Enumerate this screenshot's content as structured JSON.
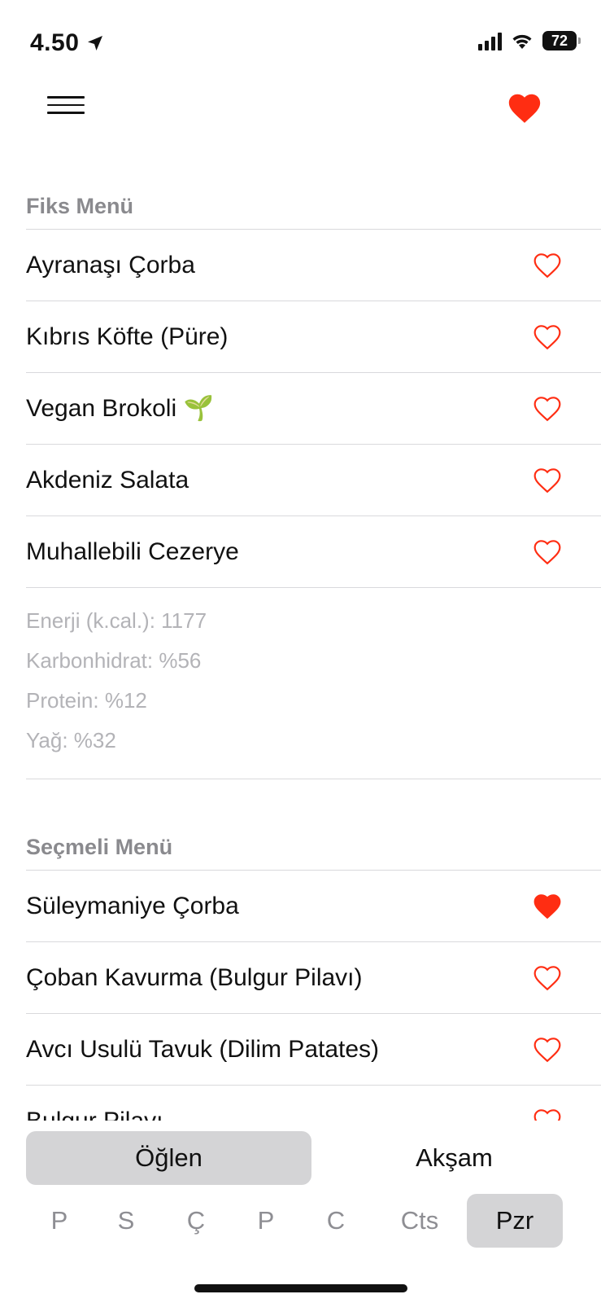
{
  "status": {
    "time": "4.50",
    "battery": "72"
  },
  "sections": [
    {
      "title": "Fiks Menü",
      "items": [
        {
          "label": "Ayranaşı Çorba",
          "favorite": false
        },
        {
          "label": "Kıbrıs Köfte (Püre)",
          "favorite": false
        },
        {
          "label": "Vegan Brokoli 🌱",
          "favorite": false
        },
        {
          "label": "Akdeniz Salata",
          "favorite": false
        },
        {
          "label": "Muhallebili Cezerye",
          "favorite": false
        }
      ],
      "nutrition": [
        "Enerji (k.cal.): 1177",
        "Karbonhidrat: %56",
        "Protein: %12",
        "Yağ: %32"
      ]
    },
    {
      "title": "Seçmeli Menü",
      "items": [
        {
          "label": "Süleymaniye Çorba",
          "favorite": true
        },
        {
          "label": "Çoban Kavurma (Bulgur Pilavı)",
          "favorite": false
        },
        {
          "label": "Avcı Usulü Tavuk (Dilim Patates)",
          "favorite": false
        },
        {
          "label": "Bulgur Pilavı",
          "favorite": false
        }
      ]
    }
  ],
  "meal_segment": {
    "options": [
      "Öğlen",
      "Akşam"
    ],
    "selected": "Öğlen"
  },
  "days": {
    "options": [
      "P",
      "S",
      "Ç",
      "P",
      "C",
      "Cts",
      "Pzr"
    ],
    "selected": "Pzr"
  },
  "colors": {
    "accent": "#ff2d12",
    "section_header": "#8a8a8e",
    "nutrition_text": "#b3b3b7",
    "selected_bg": "#d4d4d6"
  },
  "icons": {
    "menu": "hamburger-menu-icon",
    "favorites": "heart-filled-icon",
    "location": "location-arrow-icon",
    "wifi": "wifi-icon",
    "signal": "cellular-signal-icon"
  }
}
